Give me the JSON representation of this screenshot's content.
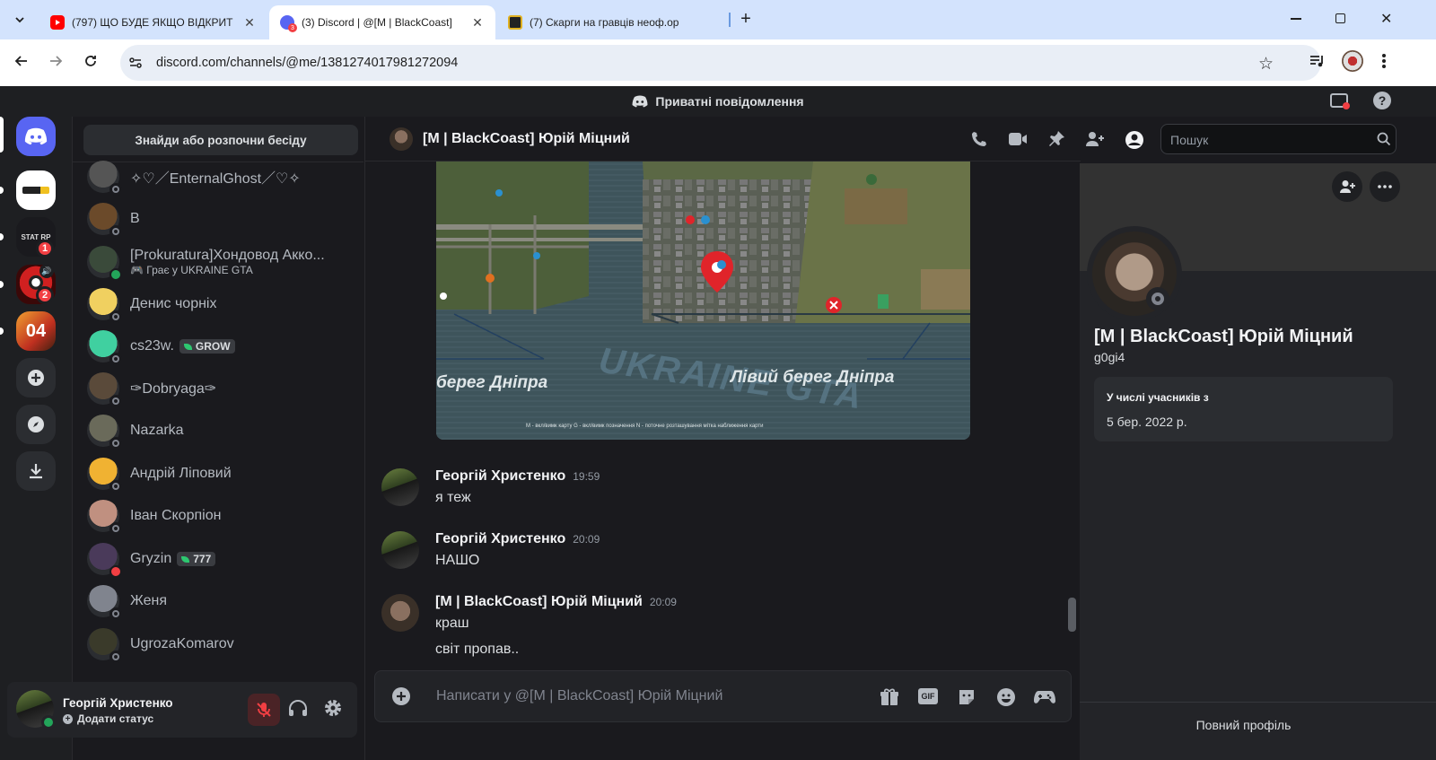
{
  "browser": {
    "tabs": [
      {
        "title": "(797) ЩО БУДЕ ЯКЩО ВІДКРИТ",
        "favicon": "youtube-icon",
        "color": "#ff0000"
      },
      {
        "title": "(3) Discord | @[M | BlackCoast]",
        "favicon": "discord-icon",
        "color": "#5865f2"
      },
      {
        "title": "(7) Скарги на гравців неоф.ор",
        "favicon": "forum-icon",
        "color": "#222222"
      }
    ],
    "url": "discord.com/channels/@me/1381274017981272094"
  },
  "topbar": {
    "title": "Приватні повідомлення"
  },
  "guilds": {
    "badges": [
      "1",
      "2"
    ]
  },
  "dm_list": {
    "find_button": "Знайди або розпочни бесіду",
    "items": [
      {
        "name": "✧♡／EnternalGhost／♡✧",
        "status": "offline",
        "color": "#555555"
      },
      {
        "name": "B",
        "status": "offline",
        "color": "#6b4a2a"
      },
      {
        "name": "[Prokuratura]Хондовод Акко...",
        "sub": "Грає у UKRAINE GTA",
        "status": "online",
        "color": "#3a4a3a"
      },
      {
        "name": "Денис чорніх",
        "status": "offline",
        "color": "#f0d060"
      },
      {
        "name": "cs23w.",
        "tag": "GROW",
        "status": "offline",
        "color": "#40d0a0"
      },
      {
        "name": "✑Dobryaga✑",
        "status": "offline",
        "color": "#5a4a3a"
      },
      {
        "name": "Nazarka",
        "status": "offline",
        "color": "#6a6a5a"
      },
      {
        "name": "Андрій Ліповий",
        "status": "offline",
        "color": "#f0b232"
      },
      {
        "name": "Іван Скорпіон",
        "status": "offline",
        "color": "#c09080"
      },
      {
        "name": "Gryzin",
        "tag": "777",
        "status": "dnd",
        "color": "#4a3a5a"
      },
      {
        "name": "Женя",
        "status": "offline",
        "color": "#80848e"
      },
      {
        "name": "UgrozaKomarov",
        "status": "offline",
        "color": "#3a3a2a"
      }
    ]
  },
  "user_panel": {
    "name": "Георгій Христенко",
    "status": "Додати статус"
  },
  "chat": {
    "title": "[M | BlackCoast] Юрій Міцний",
    "search_placeholder": "Пошук",
    "map": {
      "left_label": "берег Дніпра",
      "right_label": "Лівий берег Дніпра",
      "logo": "UKRAINE GTA",
      "legend": "M - вкл/вимк карту   G - вкл/вимк позначення   N - поточне розташування   мітка   наближення карти"
    },
    "messages": [
      {
        "author": "Георгій Христенко",
        "time": "19:59",
        "lines": [
          "я теж"
        ]
      },
      {
        "author": "Георгій Христенко",
        "time": "20:09",
        "lines": [
          "НАШО"
        ]
      },
      {
        "author": "[M | BlackCoast] Юрій Міцний",
        "time": "20:09",
        "lines": [
          "краш",
          "світ пропав.."
        ]
      }
    ],
    "composer_placeholder": "Написати у @[M | BlackCoast] Юрій Міцний"
  },
  "profile": {
    "name": "[M | BlackCoast] Юрій Міцний",
    "username": "g0gi4",
    "member_since_label": "У числі учасників з",
    "member_since": "5 бер. 2022 р.",
    "full_profile": "Повний профіль"
  }
}
